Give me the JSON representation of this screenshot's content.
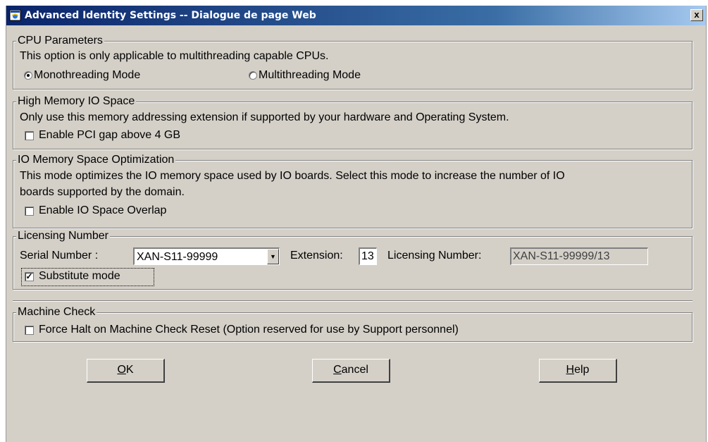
{
  "window": {
    "title": "Advanced Identity Settings -- Dialogue de page Web",
    "close_label": "x",
    "title_gradient_start": "#0a246a",
    "title_gradient_end": "#a6caf0"
  },
  "cpu": {
    "legend": "CPU Parameters",
    "description": "This option is only applicable to multithreading capable CPUs.",
    "options": [
      {
        "label": "Monothreading Mode",
        "selected": true
      },
      {
        "label": "Multithreading Mode",
        "selected": false
      }
    ]
  },
  "high_memory": {
    "legend": "High Memory IO Space",
    "description": "Only use this memory addressing extension if supported by your hardware and Operating System.",
    "checkbox_label": "Enable PCI gap above 4 GB",
    "checked": false
  },
  "io_memory": {
    "legend": "IO Memory Space Optimization",
    "description_line1": "This mode optimizes the IO memory space used by IO boards. Select this mode to increase the number of IO",
    "description_line2": "boards supported by the domain.",
    "checkbox_label": "Enable IO Space Overlap",
    "checked": false
  },
  "licensing": {
    "legend": "Licensing Number",
    "serial_label": "Serial Number :",
    "serial_value": "XAN-S11-99999",
    "extension_label": "Extension:",
    "extension_value": "13",
    "licensing_label": "Licensing Number:",
    "licensing_value": "XAN-S11-99999/13",
    "substitute_label": "Substitute mode",
    "substitute_checked": true
  },
  "machine_check": {
    "legend": "Machine Check",
    "checkbox_label": "Force Halt on Machine Check Reset (Option reserved for use by Support personnel)",
    "checked": false
  },
  "buttons": {
    "ok_accel": "O",
    "ok_rest": "K",
    "cancel_accel": "C",
    "cancel_rest": "ancel",
    "help_accel": "H",
    "help_rest": "elp"
  },
  "icons": {
    "window_icon": "ie-page-icon",
    "close_icon": "close-icon",
    "dropdown_icon": "chevron-down-icon"
  }
}
